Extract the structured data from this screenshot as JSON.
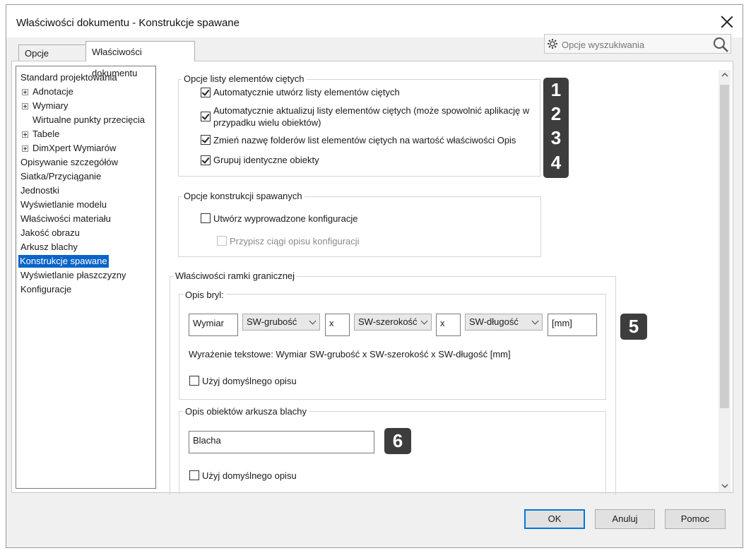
{
  "window": {
    "title": "Właściwości dokumentu - Konstrukcje spawane"
  },
  "tabs": [
    {
      "label": "Opcje systemu"
    },
    {
      "label": "Właściwości dokumentu"
    }
  ],
  "search": {
    "placeholder": "Opcje wyszukiwania"
  },
  "tree": {
    "items": [
      {
        "label": "Standard projektowania",
        "expandable": false
      },
      {
        "label": "Adnotacje",
        "expandable": true
      },
      {
        "label": "Wymiary",
        "expandable": true
      },
      {
        "label": "Wirtualne punkty przecięcia",
        "expandable": false
      },
      {
        "label": "Tabele",
        "expandable": true
      },
      {
        "label": "DimXpert Wymiarów",
        "expandable": true
      },
      {
        "label": "Opisywanie szczegółów",
        "expandable": false
      },
      {
        "label": "Siatka/Przyciąganie",
        "expandable": false
      },
      {
        "label": "Jednostki",
        "expandable": false
      },
      {
        "label": "Wyświetlanie modelu",
        "expandable": false
      },
      {
        "label": "Właściwości materiału",
        "expandable": false
      },
      {
        "label": "Jakość obrazu",
        "expandable": false
      },
      {
        "label": "Arkusz blachy",
        "expandable": false
      },
      {
        "label": "Konstrukcje spawane",
        "expandable": false,
        "selected": true
      },
      {
        "label": "Wyświetlanie płaszczyzny",
        "expandable": false
      },
      {
        "label": "Konfiguracje",
        "expandable": false
      }
    ]
  },
  "cutlist": {
    "title": "Opcje listy elementów ciętych",
    "options": [
      {
        "label": "Automatycznie utwórz listy elementów ciętych",
        "checked": true
      },
      {
        "label_line1": "Automatycznie aktualizuj listy elementów ciętych (może spowolnić aplikację w",
        "label_line2": "przypadku wielu obiektów)",
        "checked": true
      },
      {
        "label": "Zmień nazwę folderów list elementów ciętych na wartość właściwości Opis",
        "checked": true
      },
      {
        "label": "Grupuj identyczne obiekty",
        "checked": true
      }
    ]
  },
  "weldment": {
    "title": "Opcje konstrukcji spawanych",
    "create_derived": {
      "label": "Utwórz wyprowadzone konfiguracje",
      "checked": false
    },
    "assign_desc": {
      "label": "Przypisz ciągi opisu konfiguracji",
      "checked": false,
      "disabled": true
    }
  },
  "bbox": {
    "title": "Właściwości ramki granicznej",
    "solids": {
      "title": "Opis bryl:",
      "field1": "Wymiar",
      "combo1": "SW-grubość",
      "sep1": "x",
      "combo2": "SW-szerokość",
      "sep2": "x",
      "combo3": "SW-długość",
      "units": "[mm]",
      "expression": "Wyrażenie tekstowe: Wymiar SW-grubość x SW-szerokość x SW-długość [mm]",
      "use_default": {
        "label": "Użyj domyślnego opisu",
        "checked": false
      }
    },
    "sheetmetal": {
      "title": "Opis obiektów arkusza blachy",
      "field": "Blacha",
      "use_default": {
        "label": "Użyj domyślnego opisu",
        "checked": false
      }
    }
  },
  "badges": [
    "1",
    "2",
    "3",
    "4",
    "5",
    "6"
  ],
  "buttons": {
    "ok": "OK",
    "cancel": "Anuluj",
    "help": "Pomoc"
  },
  "colors": {
    "selection": "#0a64c8",
    "badge": "#3d3d3d",
    "default_button_border": "#0078d7"
  }
}
